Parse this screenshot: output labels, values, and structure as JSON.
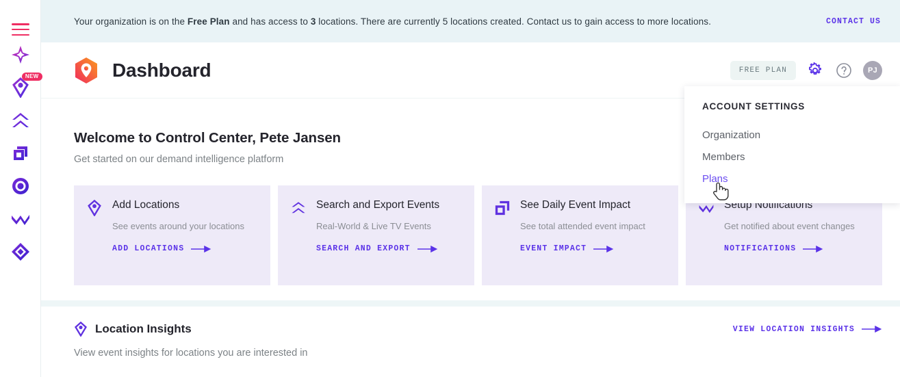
{
  "banner": {
    "text_before": "Your organization is on the ",
    "plan_bold": "Free Plan",
    "text_mid": " and has access to ",
    "count_bold": "3",
    "text_after": " locations. There are currently 5 locations created. Contact us to gain access to more locations.",
    "cta_label": "CONTACT US"
  },
  "header": {
    "title": "Dashboard",
    "plan_chip": "FREE PLAN",
    "avatar_initials": "PJ",
    "gear_icon": "gear-icon",
    "help_icon": "question-circle-icon",
    "logo_icon": "location-pin-hexagon-logo"
  },
  "sidebar": {
    "menu_icon": "hamburger-menu-icon",
    "items": [
      {
        "icon": "sparkle-star-icon",
        "badge": ""
      },
      {
        "icon": "location-pin-diamond-icon",
        "badge": "NEW"
      },
      {
        "icon": "double-chevron-up-icon",
        "badge": ""
      },
      {
        "icon": "overlapping-squares-icon",
        "badge": ""
      },
      {
        "icon": "target-circle-icon",
        "badge": ""
      },
      {
        "icon": "zigzag-wave-icon",
        "badge": ""
      },
      {
        "icon": "nested-diamond-icon",
        "badge": ""
      }
    ]
  },
  "welcome": {
    "title": "Welcome to Control Center, Pete Jansen",
    "subtitle": "Get started on our demand intelligence platform"
  },
  "cards": [
    {
      "icon": "location-pin-icon",
      "title": "Add Locations",
      "desc": "See events around your locations",
      "link": "ADD LOCATIONS"
    },
    {
      "icon": "double-chevron-up-icon",
      "title": "Search and Export Events",
      "desc": "Real-World & Live TV Events",
      "link": "SEARCH AND EXPORT"
    },
    {
      "icon": "overlapping-squares-icon",
      "title": "See Daily Event Impact",
      "desc": "See total attended event impact",
      "link": "EVENT IMPACT"
    },
    {
      "icon": "zigzag-wave-icon",
      "title": "Setup Notifications",
      "desc": "Get notified about event changes",
      "link": "NOTIFICATIONS"
    }
  ],
  "insights": {
    "icon": "location-pin-icon",
    "title": "Location Insights",
    "subtitle": "View event insights for locations you are interested in",
    "link": "VIEW LOCATION INSIGHTS"
  },
  "dropdown": {
    "heading": "ACCOUNT SETTINGS",
    "items": [
      {
        "label": "Organization",
        "active": false
      },
      {
        "label": "Members",
        "active": false
      },
      {
        "label": "Plans",
        "active": true
      }
    ]
  },
  "colors": {
    "accent_purple": "#5b33e8",
    "accent_pink": "#ef2e63",
    "card_bg": "#eeeaf8",
    "banner_bg": "#e9f3f6",
    "muted_text": "#8b8e94"
  }
}
